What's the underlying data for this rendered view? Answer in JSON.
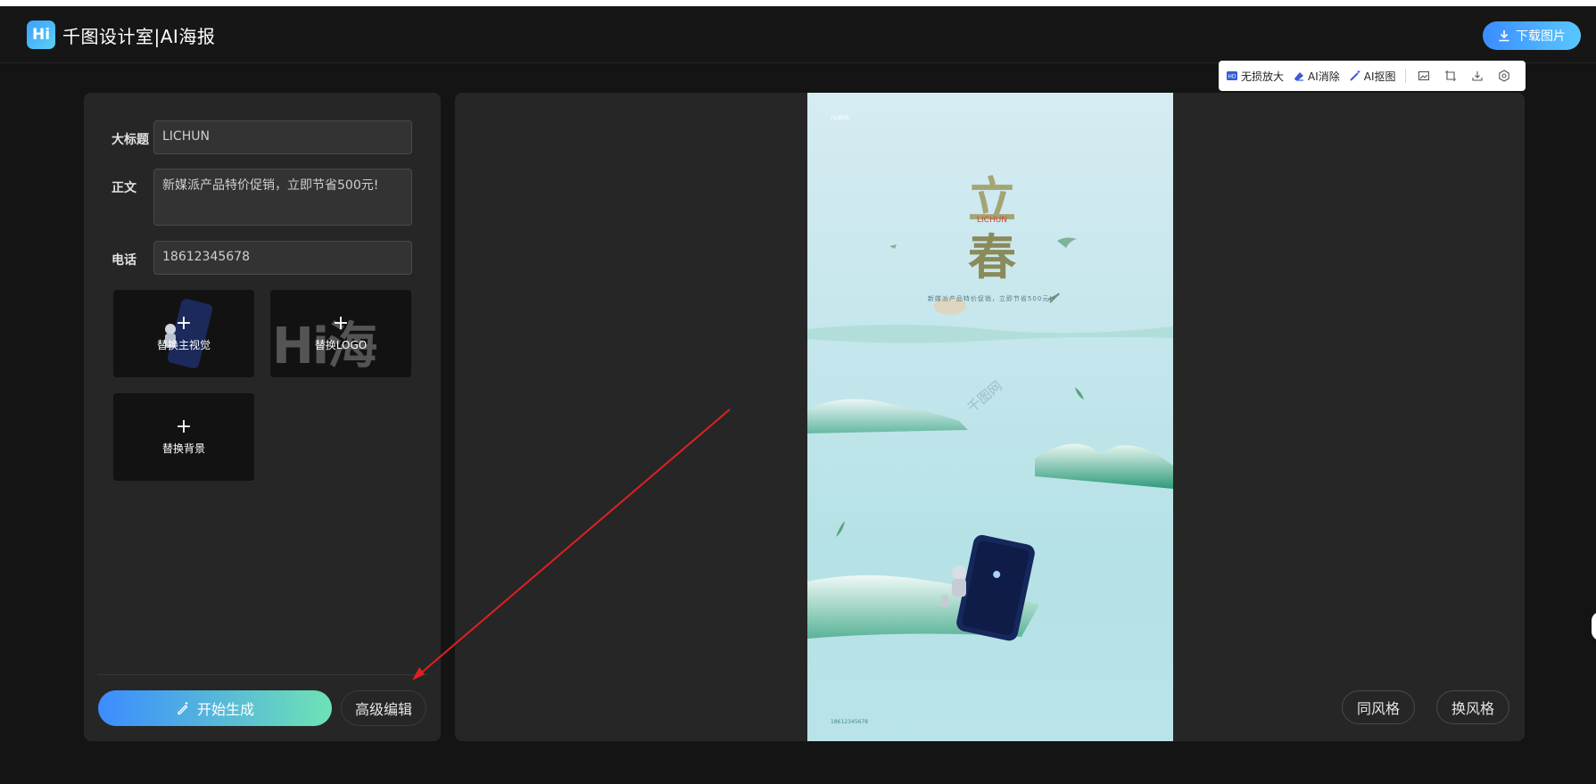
{
  "header": {
    "logo_mark": "Hi",
    "logo_text": "千图设计室|AI海报",
    "download_label": "下载图片"
  },
  "toolbar": {
    "upscale_label": "无损放大",
    "erase_label": "AI消除",
    "cutout_label": "AI抠图"
  },
  "form": {
    "title_label": "大标题",
    "title_value": "LICHUN",
    "body_label": "正文",
    "body_value": "新媒派产品特价促销，立即节省500元!",
    "phone_label": "电话",
    "phone_value": "18612345678"
  },
  "tiles": {
    "plus": "+",
    "main_visual_label": "替换主视觉",
    "logo_label": "替换LOGO",
    "logo_watermark": "Hi海报",
    "background_label": "替换背景"
  },
  "actions": {
    "generate_label": "开始生成",
    "advanced_label": "高级编辑",
    "same_style_label": "同风格",
    "change_style_label": "换风格"
  },
  "poster": {
    "top_text": "rsiBdk",
    "char_top": "立",
    "en_title": "LICHUN",
    "char_bottom": "春",
    "body_text": "新媒派产品特价促销，立即节省500元!",
    "phone": "18612345678",
    "watermark": "千图网"
  },
  "colors": {
    "background": "#141414",
    "panel": "#262626",
    "accent_blue": "#3b8cff",
    "accent_green": "#6fe2b5",
    "arrow_red": "#e02020"
  }
}
